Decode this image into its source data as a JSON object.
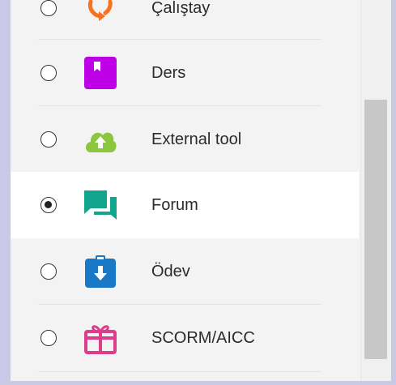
{
  "activity_chooser": {
    "items": [
      {
        "label": "Çalıştay",
        "icon": "workshop-icon",
        "selected": false
      },
      {
        "label": "Ders",
        "icon": "lesson-icon",
        "selected": false
      },
      {
        "label": "External tool",
        "icon": "external-tool-icon",
        "selected": false
      },
      {
        "label": "Forum",
        "icon": "forum-icon",
        "selected": true
      },
      {
        "label": "Ödev",
        "icon": "assignment-icon",
        "selected": false
      },
      {
        "label": "SCORM/AICC",
        "icon": "scorm-package-icon",
        "selected": false
      }
    ]
  },
  "colors": {
    "workshop": "#f7721e",
    "lesson": "#bd00e6",
    "external_tool": "#8cc63f",
    "forum": "#11a68d",
    "assignment": "#1a79c6",
    "scorm": "#dd3e8b"
  }
}
